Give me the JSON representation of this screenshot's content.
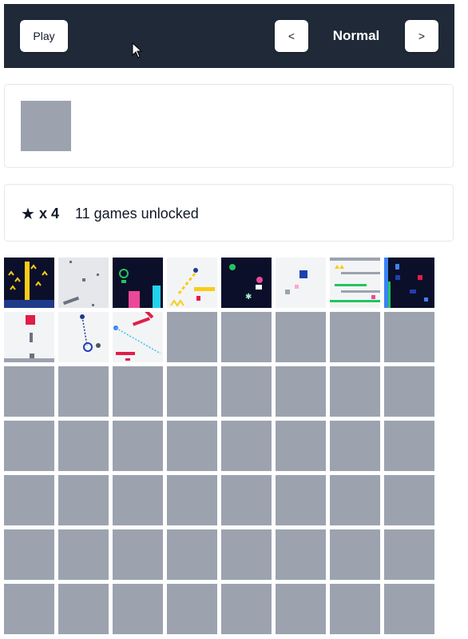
{
  "toolbar": {
    "play_label": "Play",
    "prev_label": "<",
    "mode_label": "Normal",
    "next_label": ">"
  },
  "stats": {
    "star_icon": "★",
    "star_count": "x 4",
    "unlocked_text": "11 games unlocked"
  },
  "grid": {
    "unlocked": [
      {
        "thumb": "fire-level"
      },
      {
        "thumb": "falling-blocks"
      },
      {
        "thumb": "neon-jump"
      },
      {
        "thumb": "yellow-dash"
      },
      {
        "thumb": "space-dodge"
      },
      {
        "thumb": "square-puzzle"
      },
      {
        "thumb": "platform-ladder"
      },
      {
        "thumb": "night-city"
      },
      {
        "thumb": "red-cube-drop"
      },
      {
        "thumb": "pendulum-swing"
      },
      {
        "thumb": "laser-bounce"
      }
    ],
    "locked_count": 45
  },
  "colors": {
    "topbar_bg": "#1f2937",
    "locked_tile": "#9ca3af",
    "panel_border": "#e5e7eb"
  }
}
